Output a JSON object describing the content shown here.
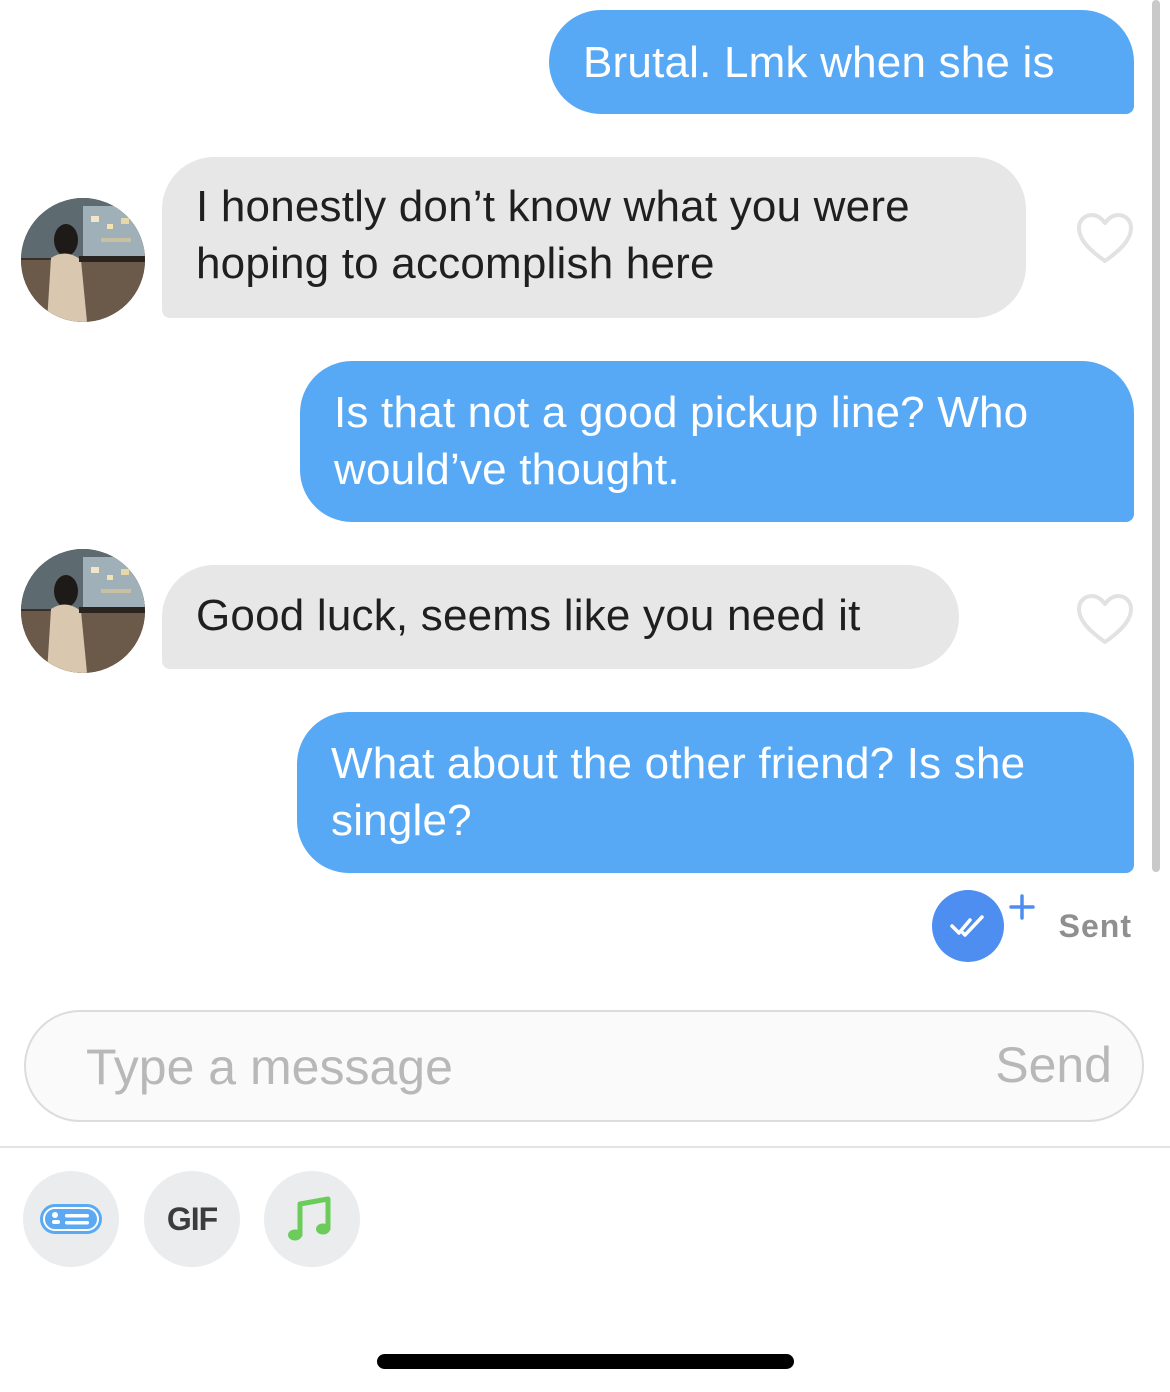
{
  "conversation": {
    "messages": [
      {
        "direction": "out",
        "text": "Brutal. Lmk when she is"
      },
      {
        "direction": "in",
        "text": "I honestly don’t know what you were hoping to accomplish here"
      },
      {
        "direction": "out",
        "text": "Is that not a good pickup line? Who would’ve thought."
      },
      {
        "direction": "in",
        "text": "Good luck, seems like you need it"
      },
      {
        "direction": "out",
        "text": "What about the other friend? Is she single?"
      }
    ],
    "status": "Sent"
  },
  "composer": {
    "placeholder": "Type a message",
    "send_label": "Send"
  },
  "toolbar": {
    "gif_label": "GIF"
  },
  "colors": {
    "outgoing_bubble": "#58a9f5",
    "incoming_bubble": "#e7e7e7",
    "read_receipt": "#4d8ef0",
    "music_icon": "#6ccc5b",
    "sticker_icon": "#5aa9f2"
  },
  "icons": {
    "like": "heart-outline-icon",
    "read_receipt": "double-check-icon",
    "boost": "plus-icon",
    "sticker": "sticker-icon",
    "music": "music-note-icon"
  }
}
